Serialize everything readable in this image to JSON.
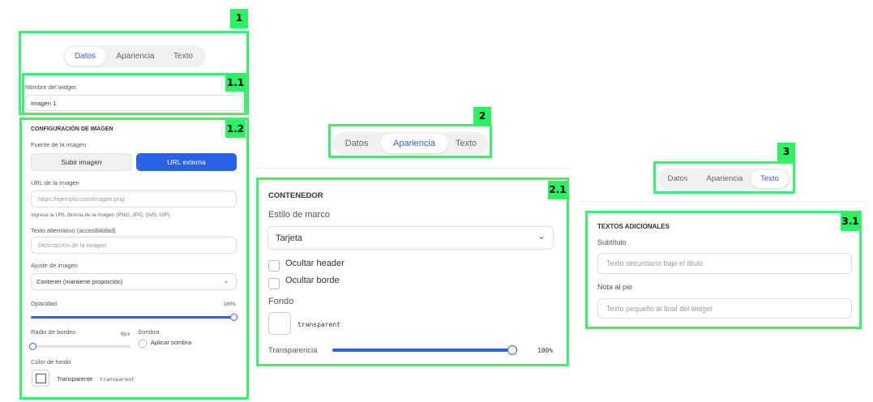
{
  "panel1": {
    "tag": "1",
    "tabs": [
      {
        "label": "Datos",
        "active": true
      },
      {
        "label": "Apariencia",
        "active": false
      },
      {
        "label": "Texto",
        "active": false
      }
    ],
    "widget_name": {
      "tag": "1.1",
      "label": "Nombre del widget",
      "value": "Imagen 1"
    },
    "image_config": {
      "tag": "1.2",
      "heading": "CONFIGURACIÓN DE IMAGEN",
      "source_label": "Fuente de la imagen",
      "upload_label": "Subir imagen",
      "external_url_label": "URL externa",
      "url_label": "URL de la imagen",
      "url_placeholder": "https://ejemplo.com/imagen.png",
      "url_hint": "Ingresa la URL directa de la imagen (PNG, JPG, SVG, GIF)",
      "alt_label": "Texto alternativo (accesibilidad)",
      "alt_placeholder": "Descripción de la imagen",
      "fit_label": "Ajuste de imagen",
      "fit_value": "Contener (mantiene proporción)",
      "opacity_label": "Opacidad",
      "opacity_value": "100%",
      "opacity_level": 1.0,
      "radius_label": "Radio de bordes",
      "radius_value": "0px",
      "radius_level": 0,
      "shadow_label": "Sombra",
      "shadow_checkbox_label": "Aplicar sombra",
      "bg_label": "Color de fondo",
      "bg_name": "Transparente",
      "bg_value": "transparent"
    }
  },
  "panel2": {
    "tag": "2",
    "tabs": [
      {
        "label": "Datos",
        "active": false
      },
      {
        "label": "Apariencia",
        "active": true
      },
      {
        "label": "Texto",
        "active": false
      }
    ],
    "container": {
      "tag": "2.1",
      "heading": "CONTENEDOR",
      "frame_style_label": "Estilo de marco",
      "frame_style_value": "Tarjeta",
      "hide_header_label": "Ocultar header",
      "hide_border_label": "Ocultar borde",
      "background_label": "Fondo",
      "background_value": "transparent",
      "transparency_label": "Transparencia",
      "transparency_value": "100%",
      "transparency_level": 1.0
    }
  },
  "panel3": {
    "tag": "3",
    "tabs": [
      {
        "label": "Datos",
        "active": false
      },
      {
        "label": "Apariencia",
        "active": false
      },
      {
        "label": "Texto",
        "active": true
      }
    ],
    "texts": {
      "tag": "3.1",
      "heading": "TEXTOS ADICIONALES",
      "subtitle_label": "Subtítulo",
      "subtitle_placeholder": "Texto secundario bajo el título",
      "footnote_label": "Nota al pie",
      "footnote_placeholder": "Texto pequeño al final del widget"
    }
  },
  "colors": {
    "highlight": "#3df06e",
    "accent": "#2a62e6"
  }
}
